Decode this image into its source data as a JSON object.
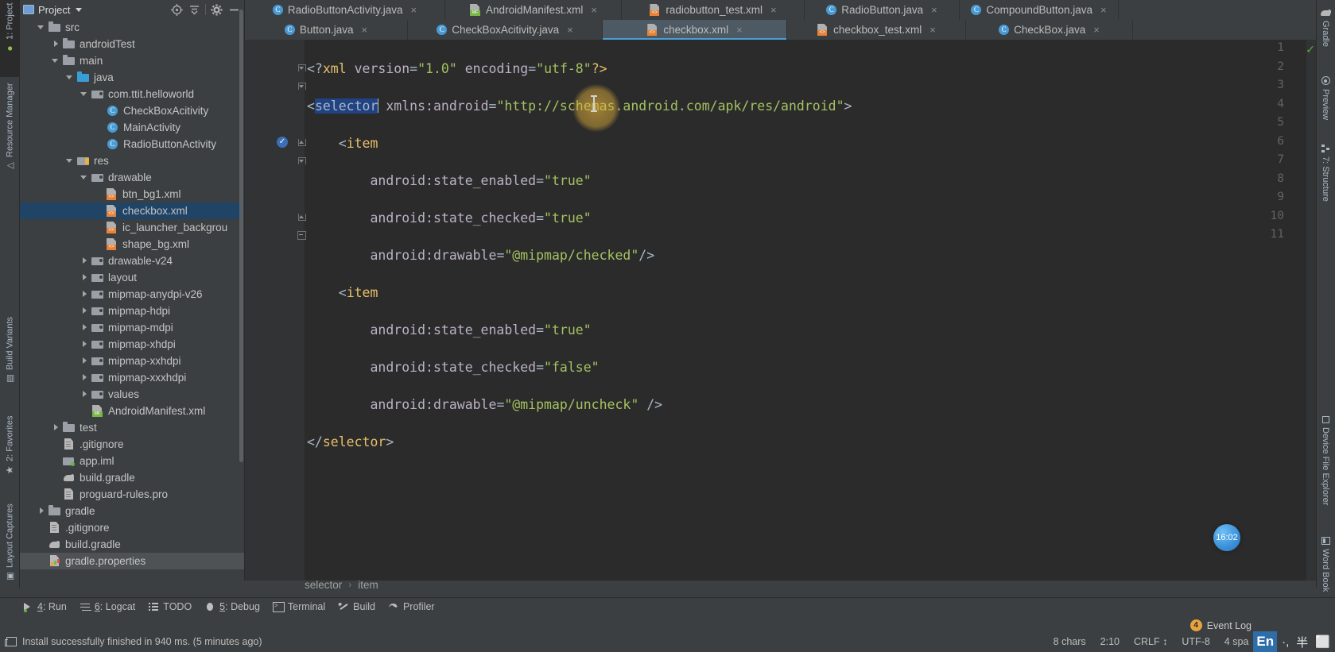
{
  "left_rail": [
    {
      "label": "1: Project",
      "icon": "android-icon",
      "active": true
    },
    {
      "label": "Resource Manager",
      "icon": "resource-manager-icon",
      "active": false
    },
    {
      "label": "Build Variants",
      "icon": "build-variants-icon",
      "active": false
    },
    {
      "label": "2: Favorites",
      "icon": "star-icon",
      "active": false
    },
    {
      "label": "Layout Captures",
      "icon": "layout-captures-icon",
      "active": false
    }
  ],
  "right_rail": [
    {
      "label": "Gradle",
      "icon": "gradle-elephant-icon"
    },
    {
      "label": "Preview",
      "icon": "eye-icon"
    },
    {
      "label": "7: Structure",
      "icon": "structure-icon"
    },
    {
      "label": "Device File Explorer",
      "icon": "device-icon"
    },
    {
      "label": "Word Book",
      "icon": "word-book-icon"
    }
  ],
  "project_panel": {
    "title": "Project",
    "toolbar": [
      {
        "name": "locate-icon",
        "label": "Select Opened File"
      },
      {
        "name": "collapse-all-icon",
        "label": "Collapse All"
      },
      {
        "name": "gear-icon",
        "label": "Settings"
      },
      {
        "name": "minimize-icon",
        "label": "Hide"
      }
    ],
    "tree": [
      {
        "depth": 1,
        "arrow": "open",
        "icon": "folder",
        "label": "src",
        "state": "none"
      },
      {
        "depth": 2,
        "arrow": "closed",
        "icon": "folder",
        "label": "androidTest",
        "state": "none"
      },
      {
        "depth": 2,
        "arrow": "open",
        "icon": "folder",
        "label": "main",
        "state": "none"
      },
      {
        "depth": 3,
        "arrow": "open",
        "icon": "folder-blue",
        "label": "java",
        "state": "none"
      },
      {
        "depth": 4,
        "arrow": "open",
        "icon": "folder-pkg",
        "label": "com.ttit.helloworld",
        "state": "none"
      },
      {
        "depth": 5,
        "arrow": "none",
        "icon": "cls",
        "label": "CheckBoxAcitivity",
        "state": "none"
      },
      {
        "depth": 5,
        "arrow": "none",
        "icon": "cls",
        "label": "MainActivity",
        "state": "none"
      },
      {
        "depth": 5,
        "arrow": "none",
        "icon": "cls",
        "label": "RadioButtonActivity",
        "state": "none"
      },
      {
        "depth": 3,
        "arrow": "open",
        "icon": "folder-res",
        "label": "res",
        "state": "none"
      },
      {
        "depth": 4,
        "arrow": "open",
        "icon": "folder-pkg",
        "label": "drawable",
        "state": "none"
      },
      {
        "depth": 5,
        "arrow": "none",
        "icon": "xml",
        "label": "btn_bg1.xml",
        "state": "none"
      },
      {
        "depth": 5,
        "arrow": "none",
        "icon": "xml",
        "label": "checkbox.xml",
        "state": "selected"
      },
      {
        "depth": 5,
        "arrow": "none",
        "icon": "xml",
        "label": "ic_launcher_backgrou",
        "state": "none"
      },
      {
        "depth": 5,
        "arrow": "none",
        "icon": "xml",
        "label": "shape_bg.xml",
        "state": "none"
      },
      {
        "depth": 4,
        "arrow": "closed",
        "icon": "folder-pkg",
        "label": "drawable-v24",
        "state": "none"
      },
      {
        "depth": 4,
        "arrow": "closed",
        "icon": "folder-pkg",
        "label": "layout",
        "state": "none"
      },
      {
        "depth": 4,
        "arrow": "closed",
        "icon": "folder-pkg",
        "label": "mipmap-anydpi-v26",
        "state": "none"
      },
      {
        "depth": 4,
        "arrow": "closed",
        "icon": "folder-pkg",
        "label": "mipmap-hdpi",
        "state": "none"
      },
      {
        "depth": 4,
        "arrow": "closed",
        "icon": "folder-pkg",
        "label": "mipmap-mdpi",
        "state": "none"
      },
      {
        "depth": 4,
        "arrow": "closed",
        "icon": "folder-pkg",
        "label": "mipmap-xhdpi",
        "state": "none"
      },
      {
        "depth": 4,
        "arrow": "closed",
        "icon": "folder-pkg",
        "label": "mipmap-xxhdpi",
        "state": "none"
      },
      {
        "depth": 4,
        "arrow": "closed",
        "icon": "folder-pkg",
        "label": "mipmap-xxxhdpi",
        "state": "none"
      },
      {
        "depth": 4,
        "arrow": "closed",
        "icon": "folder-pkg",
        "label": "values",
        "state": "none"
      },
      {
        "depth": 4,
        "arrow": "none",
        "icon": "manifest",
        "label": "AndroidManifest.xml",
        "state": "none"
      },
      {
        "depth": 2,
        "arrow": "closed",
        "icon": "folder",
        "label": "test",
        "state": "none"
      },
      {
        "depth": 2,
        "arrow": "none",
        "icon": "file",
        "label": ".gitignore",
        "state": "none"
      },
      {
        "depth": 2,
        "arrow": "none",
        "icon": "iml",
        "label": "app.iml",
        "state": "none"
      },
      {
        "depth": 2,
        "arrow": "none",
        "icon": "gradle",
        "label": "build.gradle",
        "state": "none"
      },
      {
        "depth": 2,
        "arrow": "none",
        "icon": "file",
        "label": "proguard-rules.pro",
        "state": "none"
      },
      {
        "depth": 1,
        "arrow": "closed",
        "icon": "folder",
        "label": "gradle",
        "state": "none"
      },
      {
        "depth": 1,
        "arrow": "none",
        "icon": "file",
        "label": ".gitignore",
        "state": "none"
      },
      {
        "depth": 1,
        "arrow": "none",
        "icon": "gradle",
        "label": "build.gradle",
        "state": "none"
      },
      {
        "depth": 1,
        "arrow": "none",
        "icon": "props",
        "label": "gradle.properties",
        "state": "hover"
      }
    ]
  },
  "editor_tabs": {
    "row1": [
      {
        "label": "RadioButtonActivity.java",
        "icon": "cls",
        "active": false,
        "close": "×"
      },
      {
        "label": "AndroidManifest.xml",
        "icon": "manifest",
        "active": false,
        "close": "×"
      },
      {
        "label": "radiobutton_test.xml",
        "icon": "xml",
        "active": false,
        "close": "×"
      },
      {
        "label": "RadioButton.java",
        "icon": "cls",
        "active": false,
        "close": "×"
      },
      {
        "label": "CompoundButton.java",
        "icon": "cls",
        "active": false,
        "close": "×"
      }
    ],
    "row2": [
      {
        "label": "Button.java",
        "icon": "cls",
        "active": false,
        "close": "×"
      },
      {
        "label": "CheckBoxAcitivity.java",
        "icon": "cls",
        "active": false,
        "close": "×"
      },
      {
        "label": "checkbox.xml",
        "icon": "xml",
        "active": true,
        "close": "×"
      },
      {
        "label": "checkbox_test.xml",
        "icon": "xml",
        "active": false,
        "close": "×"
      },
      {
        "label": "CheckBox.java",
        "icon": "cls",
        "active": false,
        "close": "×"
      }
    ]
  },
  "code": {
    "lines": [
      "1",
      "2",
      "3",
      "4",
      "5",
      "6",
      "7",
      "8",
      "9",
      "10",
      "11"
    ],
    "text": [
      "<?xml version=\"1.0\" encoding=\"utf-8\"?>",
      "<selector xmlns:android=\"http://schemas.android.com/apk/res/android\">",
      "    <item",
      "        android:state_enabled=\"true\"",
      "        android:state_checked=\"true\"",
      "        android:drawable=\"@mipmap/checked\"/>",
      "    <item",
      "        android:state_enabled=\"true\"",
      "        android:state_checked=\"false\"",
      "        android:drawable=\"@mipmap/uncheck\" />",
      "</selector>"
    ],
    "selected_token": "selector",
    "breakpoint_line": "6"
  },
  "breadcrumb": {
    "parent": "selector",
    "separator": "›",
    "child": "item"
  },
  "timer": {
    "value": "16:02"
  },
  "bottom_tools": [
    {
      "num": "4",
      "label": "Run",
      "icon": "run-icon"
    },
    {
      "num": "6",
      "label": "Logcat",
      "icon": "logcat-icon"
    },
    {
      "num": "",
      "label": "TODO",
      "icon": "todo-icon"
    },
    {
      "num": "5",
      "label": "Debug",
      "icon": "debug-icon"
    },
    {
      "num": "",
      "label": "Terminal",
      "icon": "terminal-icon"
    },
    {
      "num": "",
      "label": "Build",
      "icon": "build-icon"
    },
    {
      "num": "",
      "label": "Profiler",
      "icon": "profiler-icon"
    }
  ],
  "status_bar": {
    "message": "Install successfully finished in 940 ms. (5 minutes ago)",
    "chars": "8 chars",
    "caret": "2:10",
    "line_sep": "CRLF",
    "encoding": "UTF-8",
    "indent": "4 spa",
    "event_log": "Event Log",
    "event_count": "4",
    "ime": "En",
    "ime_marks": [
      "·,",
      "半",
      "⬜"
    ]
  }
}
